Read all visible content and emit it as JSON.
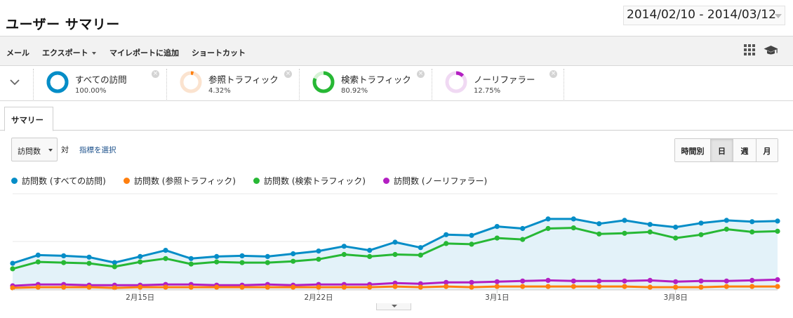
{
  "header": {
    "title": "ユーザー サマリー",
    "date_range": "2014/02/10 - 2014/03/12"
  },
  "toolbar": {
    "items": [
      {
        "label": "メール",
        "has_caret": false
      },
      {
        "label": "エクスポート",
        "has_caret": true
      },
      {
        "label": "マイレポートに追加",
        "has_caret": false
      },
      {
        "label": "ショートカット",
        "has_caret": false
      }
    ],
    "icons": [
      "grid-icon",
      "graduation-cap-icon"
    ]
  },
  "segments": [
    {
      "name": "すべての訪問",
      "percent": "100.00%",
      "fraction": 1.0,
      "color": "#058dc7",
      "track": "#058dc7"
    },
    {
      "name": "参照トラフィック",
      "percent": "4.32%",
      "fraction": 0.0432,
      "color": "#ff7f0e",
      "track": "#fbe3cf"
    },
    {
      "name": "検索トラフィック",
      "percent": "80.92%",
      "fraction": 0.8092,
      "color": "#27b835",
      "track": "#d6f2d6"
    },
    {
      "name": "ノーリファラー",
      "percent": "12.75%",
      "fraction": 0.1275,
      "color": "#b31fc2",
      "track": "#f0d9f3"
    }
  ],
  "tabs": [
    {
      "label": "サマリー"
    }
  ],
  "controls": {
    "metric": "訪問数",
    "vs": "対",
    "select_metric": "指標を選択",
    "periods": [
      {
        "label": "時間別",
        "active": false
      },
      {
        "label": "日",
        "active": true
      },
      {
        "label": "週",
        "active": false
      },
      {
        "label": "月",
        "active": false
      }
    ]
  },
  "chart_data": {
    "type": "line",
    "x": [
      "2/10",
      "2/11",
      "2/12",
      "2/13",
      "2/14",
      "2/15",
      "2/16",
      "2/17",
      "2/18",
      "2/19",
      "2/20",
      "2/21",
      "2/22",
      "2/23",
      "2/24",
      "2/25",
      "2/26",
      "2/27",
      "2/28",
      "3/1",
      "3/2",
      "3/3",
      "3/4",
      "3/5",
      "3/6",
      "3/7",
      "3/8",
      "3/9",
      "3/10",
      "3/11",
      "3/12"
    ],
    "tick_labels": [
      {
        "index": 5,
        "label": "2月15日"
      },
      {
        "index": 12,
        "label": "2月22日"
      },
      {
        "index": 19,
        "label": "3月1日"
      },
      {
        "index": 26,
        "label": "3月8日"
      }
    ],
    "ylim": [
      0,
      140
    ],
    "grid": true,
    "legend": "top-left",
    "series": [
      {
        "name": "訪問数 (すべての訪問)",
        "color": "#058dc7",
        "area": true,
        "values": [
          38,
          50,
          49,
          47,
          39,
          48,
          57,
          45,
          48,
          49,
          48,
          52,
          56,
          63,
          57,
          69,
          61,
          80,
          79,
          92,
          89,
          103,
          103,
          96,
          101,
          95,
          91,
          97,
          101,
          99,
          100
        ]
      },
      {
        "name": "訪問数 (参照トラフィック)",
        "color": "#ff7f0e",
        "area": false,
        "values": [
          2,
          3,
          3,
          3,
          2,
          3,
          3,
          3,
          3,
          3,
          3,
          3,
          3,
          3,
          3,
          4,
          3,
          4,
          3,
          4,
          4,
          4,
          4,
          4,
          4,
          3,
          3,
          3,
          4,
          4,
          4
        ]
      },
      {
        "name": "訪問数 (検索トラフィック)",
        "color": "#27b835",
        "area": false,
        "values": [
          30,
          40,
          39,
          38,
          33,
          40,
          45,
          37,
          40,
          39,
          39,
          41,
          44,
          51,
          48,
          51,
          50,
          67,
          66,
          75,
          73,
          89,
          90,
          81,
          82,
          84,
          75,
          80,
          88,
          84,
          85
        ]
      },
      {
        "name": "訪問数 (ノーリファラー)",
        "color": "#b31fc2",
        "area": false,
        "values": [
          5,
          7,
          7,
          6,
          6,
          6,
          7,
          7,
          6,
          6,
          7,
          6,
          7,
          7,
          7,
          9,
          8,
          10,
          10,
          11,
          12,
          13,
          12,
          12,
          12,
          13,
          11,
          12,
          12,
          13,
          14
        ]
      }
    ]
  }
}
